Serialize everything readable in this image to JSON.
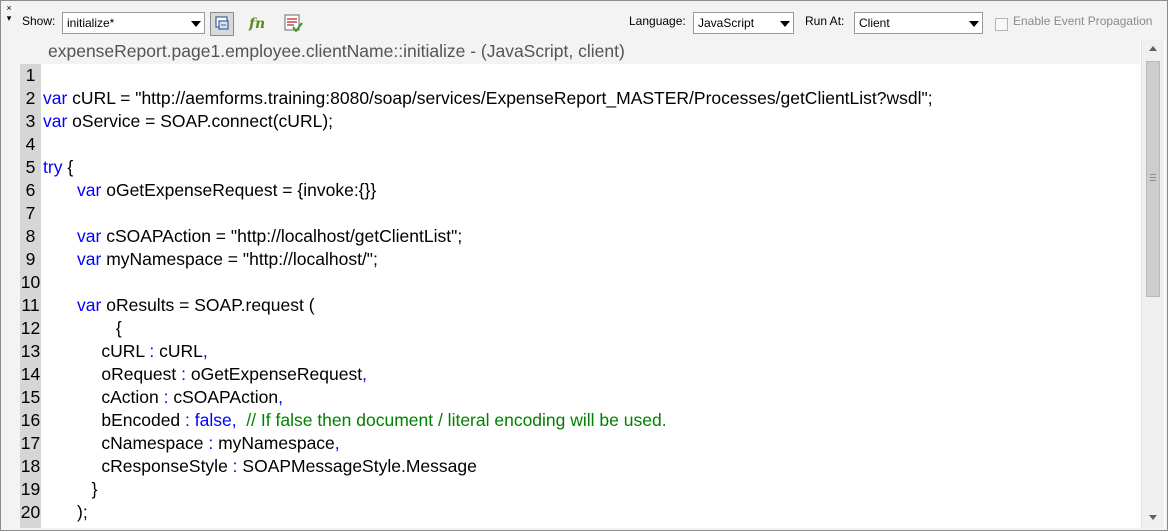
{
  "toolbar": {
    "collapse_glyph": "×\n▾",
    "show_label": "Show:",
    "show_value": "initialize*",
    "language_label": "Language:",
    "language_value": "JavaScript",
    "run_at_label": "Run At:",
    "run_at_value": "Client",
    "event_propagation_label": "Enable Event Propagation",
    "event_propagation_checked": false,
    "icons": [
      "multiple-events-icon",
      "functions-icon",
      "check-script-syntax-icon"
    ],
    "colors": {
      "function_icon": "#5a8a1e",
      "accent_icon": "#c33b3b"
    }
  },
  "editor": {
    "caption": "expenseReport.page1.employee.clientName::initialize - (JavaScript, client)",
    "colors": {
      "keyword": "#0000ff",
      "comment": "#008000",
      "text": "#000000",
      "gutter": "#d6d6d6"
    },
    "lines": [
      {
        "num": "1",
        "segments": []
      },
      {
        "num": "2",
        "segments": [
          {
            "t": "var",
            "c": "kw"
          },
          {
            "t": " cURL = \"http://aemforms.training:8080/soap/services/ExpenseReport_MASTER/Processes/getClientList?wsdl\";",
            "c": ""
          }
        ]
      },
      {
        "num": "3",
        "segments": [
          {
            "t": "var",
            "c": "kw"
          },
          {
            "t": " oService = SOAP.connect(cURL);",
            "c": ""
          }
        ]
      },
      {
        "num": "4",
        "segments": []
      },
      {
        "num": "5",
        "segments": [
          {
            "t": "try",
            "c": "kw"
          },
          {
            "t": " {",
            "c": ""
          }
        ]
      },
      {
        "num": "6",
        "segments": [
          {
            "t": "       ",
            "c": ""
          },
          {
            "t": "var",
            "c": "kw"
          },
          {
            "t": " oGetExpenseRequest = {invoke:{}}",
            "c": ""
          }
        ]
      },
      {
        "num": "7",
        "segments": []
      },
      {
        "num": "8",
        "segments": [
          {
            "t": "       ",
            "c": ""
          },
          {
            "t": "var",
            "c": "kw"
          },
          {
            "t": " cSOAPAction = \"http://localhost/getClientList\";",
            "c": ""
          }
        ]
      },
      {
        "num": "9",
        "segments": [
          {
            "t": "       ",
            "c": ""
          },
          {
            "t": "var",
            "c": "kw"
          },
          {
            "t": " myNamespace = \"http://localhost/\";",
            "c": ""
          }
        ]
      },
      {
        "num": "10",
        "segments": []
      },
      {
        "num": "11",
        "segments": [
          {
            "t": "       ",
            "c": ""
          },
          {
            "t": "var",
            "c": "kw"
          },
          {
            "t": " oResults = SOAP.request (",
            "c": ""
          }
        ]
      },
      {
        "num": "12",
        "segments": [
          {
            "t": "               {",
            "c": ""
          }
        ]
      },
      {
        "num": "13",
        "segments": [
          {
            "t": "            cURL ",
            "c": ""
          },
          {
            "t": ":",
            "c": "kw"
          },
          {
            "t": " cURL",
            "c": ""
          },
          {
            "t": ",",
            "c": "kw"
          }
        ]
      },
      {
        "num": "14",
        "segments": [
          {
            "t": "            oRequest ",
            "c": ""
          },
          {
            "t": ":",
            "c": "kw"
          },
          {
            "t": " oGetExpenseRequest",
            "c": ""
          },
          {
            "t": ",",
            "c": "kw"
          }
        ]
      },
      {
        "num": "15",
        "segments": [
          {
            "t": "            cAction ",
            "c": ""
          },
          {
            "t": ":",
            "c": "kw"
          },
          {
            "t": " cSOAPAction",
            "c": ""
          },
          {
            "t": ",",
            "c": "kw"
          }
        ]
      },
      {
        "num": "16",
        "segments": [
          {
            "t": "            bEncoded ",
            "c": ""
          },
          {
            "t": ": false,",
            "c": "kw"
          },
          {
            "t": "  // If false then document / literal encoding will be used.",
            "c": "cm"
          }
        ]
      },
      {
        "num": "17",
        "segments": [
          {
            "t": "            cNamespace ",
            "c": ""
          },
          {
            "t": ":",
            "c": "kw"
          },
          {
            "t": " myNamespace",
            "c": ""
          },
          {
            "t": ",",
            "c": "kw"
          }
        ]
      },
      {
        "num": "18",
        "segments": [
          {
            "t": "            cResponseStyle ",
            "c": ""
          },
          {
            "t": ":",
            "c": "kw"
          },
          {
            "t": " SOAPMessageStyle.Message",
            "c": ""
          }
        ]
      },
      {
        "num": "19",
        "segments": [
          {
            "t": "          }",
            "c": ""
          }
        ]
      },
      {
        "num": "20",
        "segments": [
          {
            "t": "       );",
            "c": ""
          }
        ]
      }
    ]
  }
}
